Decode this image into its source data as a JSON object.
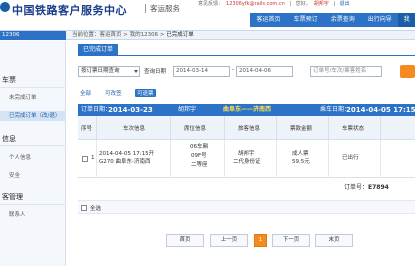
{
  "header": {
    "logo_text": "中国铁路客户服务中心",
    "logo_sub": "客运服务",
    "top_links": {
      "welcome": "意见反馈：",
      "email": "12306yfk@rails.com.cn",
      "sep1": "|",
      "greet": "您好，",
      "user": "胡邦宇",
      "sep2": "|",
      "logout": "退出"
    },
    "nav": [
      "客运首页",
      "车票预订",
      "余票查询",
      "出行向导"
    ],
    "nav_tail": "我"
  },
  "breadcrumb": {
    "left": "12306",
    "trail_prefix": "当前位置：",
    "home": "客运首页",
    "sep1": " > ",
    "my": "我的12306",
    "sep2": " > ",
    "current": "已完成订单"
  },
  "sidebar": {
    "section1": "车票",
    "unfinished": "未完成订单",
    "finished": "已完成订单（改/退）",
    "section2": "信息",
    "personal": "个人信息",
    "security": "安全",
    "section3": "客管理",
    "contacts": "联系人"
  },
  "panel": {
    "tab": "已完成订单",
    "query_type": "按订票日期查询",
    "start_label": "查询日期",
    "start_date": "2014-03-14",
    "dash": "-",
    "end_date": "2014-04-06",
    "keyword_placeholder": "订单号/车次/乘客姓名"
  },
  "filters": {
    "all": "全部",
    "changeable": "可改签",
    "refundable": "可退票"
  },
  "order": {
    "booked_label": "订单日期：",
    "booked_date": "2014-03-23",
    "passenger": "胡邦宇",
    "route": "曲阜东——济南西",
    "dep_label": "乘车日期：",
    "dep_datetime": "2014-04-05 17:15"
  },
  "table": {
    "headers": [
      "序号",
      "车次信息",
      "席位信息",
      "旅客信息",
      "票款金额",
      "车票状态"
    ],
    "row": {
      "index": "1",
      "depart": "2014-04-05 17:15开",
      "train": "G270 曲阜东-济南西",
      "car": "06车厢",
      "seat": "09F号",
      "class": "二等座",
      "passenger": "胡邦宇",
      "id_type": "二代身份证",
      "ticket_type": "成人票",
      "price": "59.5元",
      "status": "已出行"
    }
  },
  "order_no": {
    "label": "订单号：",
    "value": "E7894"
  },
  "select_all": "全选",
  "pager": {
    "first": "首页",
    "prev": "上一页",
    "current": "1",
    "next": "下一页",
    "last": "末页"
  }
}
